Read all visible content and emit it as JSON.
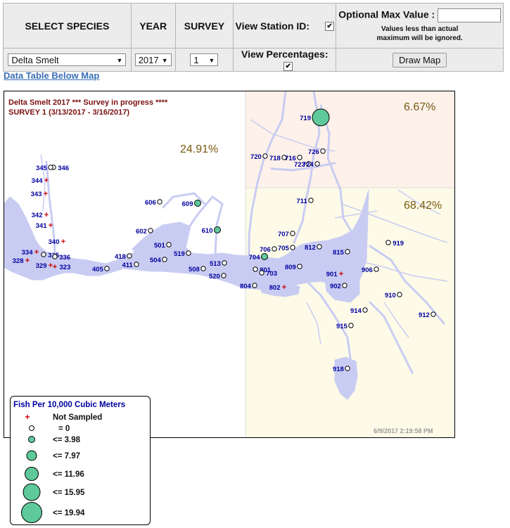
{
  "controls": {
    "species_header": "SELECT SPECIES",
    "year_header": "YEAR",
    "survey_header": "SURVEY",
    "view_station_label": "View Station ID:",
    "view_station_checked": true,
    "view_pct_label": "View Percentages:",
    "view_pct_checked": true,
    "max_label": "Optional Max Value :",
    "max_value": "",
    "max_note_line1": "Values less than actual",
    "max_note_line2": "maximum will be ignored.",
    "species_value": "Delta Smelt",
    "year_value": "2017",
    "survey_value": "1",
    "draw_button": "Draw Map"
  },
  "link": "Data Table Below Map",
  "map": {
    "title_line1": "Delta Smelt  2017 *** Survey in progress ****",
    "title_line2": "SURVEY 1  (3/13/2017  -  3/16/2017)",
    "pct_west": "24.91%",
    "pct_north": "6.67%",
    "pct_east": "68.42%",
    "timestamp": "6/9/2017 2:19:58 PM",
    "colors": {
      "fish": "#5ec99a",
      "title": "#7a1010",
      "pct": "#7a5a10",
      "label": "#0000a0",
      "water": "#c9ccf2",
      "north_bg": "#fdf1ea",
      "east_bg": "#fdfbe8",
      "not_sampled": "#d00000"
    },
    "stations": [
      {
        "id": "346",
        "cat": "zero"
      },
      {
        "id": "345",
        "cat": "zero"
      },
      {
        "id": "344",
        "cat": "ns"
      },
      {
        "id": "343",
        "cat": "ns"
      },
      {
        "id": "342",
        "cat": "ns"
      },
      {
        "id": "341",
        "cat": "ns"
      },
      {
        "id": "340",
        "cat": "ns"
      },
      {
        "id": "334",
        "cat": "ns"
      },
      {
        "id": "335",
        "cat": "zero"
      },
      {
        "id": "336",
        "cat": "zero"
      },
      {
        "id": "328",
        "cat": "ns"
      },
      {
        "id": "329",
        "cat": "ns"
      },
      {
        "id": "323",
        "cat": "ns"
      },
      {
        "id": "405",
        "cat": "zero"
      },
      {
        "id": "418",
        "cat": "zero"
      },
      {
        "id": "411",
        "cat": "zero"
      },
      {
        "id": "501",
        "cat": "zero"
      },
      {
        "id": "504",
        "cat": "zero"
      },
      {
        "id": "519",
        "cat": "zero"
      },
      {
        "id": "602",
        "cat": "zero"
      },
      {
        "id": "606",
        "cat": "zero"
      },
      {
        "id": "609",
        "cat": "fish",
        "level": "<= 3.98"
      },
      {
        "id": "610",
        "cat": "fish",
        "level": "<= 3.98"
      },
      {
        "id": "508",
        "cat": "zero"
      },
      {
        "id": "513",
        "cat": "zero"
      },
      {
        "id": "520",
        "cat": "zero"
      },
      {
        "id": "801",
        "cat": "zero"
      },
      {
        "id": "804",
        "cat": "zero"
      },
      {
        "id": "802",
        "cat": "ns"
      },
      {
        "id": "703",
        "cat": "zero"
      },
      {
        "id": "704",
        "cat": "fish",
        "level": "<= 3.98"
      },
      {
        "id": "706",
        "cat": "zero"
      },
      {
        "id": "707",
        "cat": "zero"
      },
      {
        "id": "705",
        "cat": "zero"
      },
      {
        "id": "809",
        "cat": "zero"
      },
      {
        "id": "812",
        "cat": "zero"
      },
      {
        "id": "711",
        "cat": "zero"
      },
      {
        "id": "720",
        "cat": "zero"
      },
      {
        "id": "718",
        "cat": "zero"
      },
      {
        "id": "716",
        "cat": "zero"
      },
      {
        "id": "726",
        "cat": "zero"
      },
      {
        "id": "723",
        "cat": "zero"
      },
      {
        "id": "724",
        "cat": "zero"
      },
      {
        "id": "719",
        "cat": "fish",
        "level": "<= 15.95"
      },
      {
        "id": "815",
        "cat": "zero"
      },
      {
        "id": "919",
        "cat": "zero"
      },
      {
        "id": "901",
        "cat": "ns"
      },
      {
        "id": "902",
        "cat": "zero"
      },
      {
        "id": "906",
        "cat": "zero"
      },
      {
        "id": "910",
        "cat": "zero"
      },
      {
        "id": "912",
        "cat": "zero"
      },
      {
        "id": "914",
        "cat": "zero"
      },
      {
        "id": "915",
        "cat": "zero"
      },
      {
        "id": "918",
        "cat": "zero"
      }
    ]
  },
  "legend": {
    "title": "Fish Per 10,000 Cubic Meters",
    "not_sampled": "Not Sampled",
    "zero": "= 0",
    "classes": [
      "<= 3.98",
      "<= 7.97",
      "<= 11.96",
      "<= 15.95",
      "<= 19.94"
    ]
  }
}
